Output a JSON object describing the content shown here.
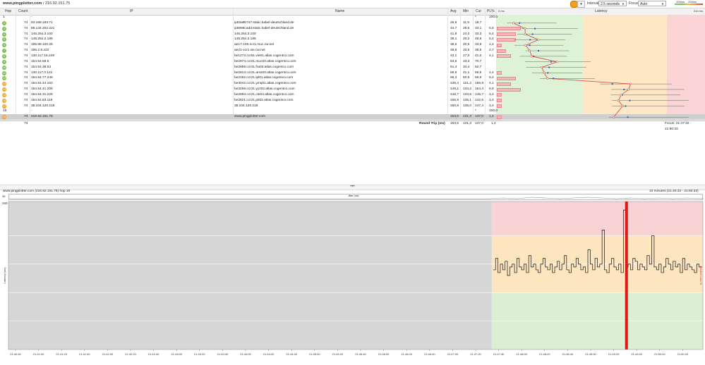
{
  "window": {
    "title_host": "www.pingplotter.com",
    "title_rest": "/ 216.92.151.75"
  },
  "toolbar": {
    "interval_label": "Interval",
    "interval_value": "2.5 seconds",
    "focus_label": "Focus",
    "focus_value": "Auto",
    "legend_good": "100ms",
    "legend_bad": "200ms"
  },
  "columns": {
    "hop": "Hop",
    "count": "Count",
    "ip": "IP",
    "name": "Name",
    "avg": "Avg",
    "min": "Min",
    "cur": "Cur",
    "pl": "PL%",
    "pl_scale": "0 ms",
    "latency": "Latency",
    "lat_max": "244 ms"
  },
  "hops": [
    {
      "hop": "1",
      "count": "",
      "ip": "-",
      "name": "",
      "avg": "",
      "min": "",
      "cur": "*",
      "pl": "100,0",
      "color": "none",
      "plbar": 0,
      "cur_ms": null,
      "min_ms": null,
      "max_ms": null
    },
    {
      "hop": "2",
      "count": "74",
      "ip": "83.169.183.71",
      "name": "ip53a9b747.static.kabel-deutschland.de",
      "avg": "26,6",
      "min": "11,9",
      "cur": "19,7",
      "pl": "",
      "color": "#7dbe4e",
      "plbar": 0,
      "cur_ms": 19.7,
      "min_ms": 11.9,
      "max_ms": 70
    },
    {
      "hop": "3",
      "count": "74",
      "ip": "88.134.202.221",
      "name": "ip5886cadd.static.kabel-deutschland.de",
      "avg": "44,7",
      "min": "28,6",
      "cur": "33,1",
      "pl": "6,8",
      "color": "#7dbe4e",
      "plbar": 34,
      "cur_ms": 33.1,
      "min_ms": 28.6,
      "max_ms": 95
    },
    {
      "hop": "4",
      "count": "74",
      "ip": "145.254.3.100",
      "name": "145.254.3.100",
      "avg": "41,9",
      "min": "24,0",
      "cur": "33,3",
      "pl": "5,4",
      "color": "#7dbe4e",
      "plbar": 27,
      "cur_ms": 33.3,
      "min_ms": 24,
      "max_ms": 88
    },
    {
      "hop": "5",
      "count": "74",
      "ip": "145.254.2.185",
      "name": "145.254.2.185",
      "avg": "39,1",
      "min": "20,2",
      "cur": "48,8",
      "pl": "5,4",
      "color": "#7dbe4e",
      "plbar": 27,
      "cur_ms": 48.8,
      "min_ms": 20.2,
      "max_ms": 80
    },
    {
      "hop": "6",
      "count": "74",
      "ip": "195.89.100.25",
      "name": "ae17-100.ncr1.muc.cw.net",
      "avg": "38,5",
      "min": "20,5",
      "cur": "33,9",
      "pl": "1,4",
      "color": "#7dbe4e",
      "plbar": 7,
      "cur_ms": 33.9,
      "min_ms": 20.5,
      "max_ms": 78
    },
    {
      "hop": "7",
      "count": "74",
      "ip": "195.2.8.222",
      "name": "ae21-xcr1.vie.cw.net",
      "avg": "48,8",
      "min": "33,5",
      "cur": "38,5",
      "pl": "2,7",
      "color": "#7dbe4e",
      "plbar": 13,
      "cur_ms": 38.5,
      "min_ms": 33.5,
      "max_ms": 85
    },
    {
      "hop": "8",
      "count": "74",
      "ip": "130.117.15.249",
      "name": "be1273.ccr51.vie01.atlas.cogentco.com",
      "avg": "43,1",
      "min": "27,0",
      "cur": "41,0",
      "pl": "4,1",
      "color": "#7dbe4e",
      "plbar": 20,
      "cur_ms": 41.0,
      "min_ms": 27,
      "max_ms": 82
    },
    {
      "hop": "9",
      "count": "74",
      "ip": "154.54.58.5",
      "name": "be2974.ccr21.muc03.atlas.cogentco.com",
      "avg": "63,6",
      "min": "33,3",
      "cur": "70,7",
      "pl": "",
      "color": "#7dbe4e",
      "plbar": 0,
      "cur_ms": 70.7,
      "min_ms": 33.3,
      "max_ms": 110
    },
    {
      "hop": "10",
      "count": "74",
      "ip": "154.54.38.53",
      "name": "be2959.ccr41.fra03.atlas.cogentco.com",
      "avg": "61,4",
      "min": "34,4",
      "cur": "52,7",
      "pl": "",
      "color": "#7dbe4e",
      "plbar": 0,
      "cur_ms": 52.7,
      "min_ms": 34.4,
      "max_ms": 105
    },
    {
      "hop": "11",
      "count": "74",
      "ip": "130.117.0.121",
      "name": "be2813.ccr41.ams03.atlas.cogentco.com",
      "avg": "59,8",
      "min": "41,1",
      "cur": "55,5",
      "pl": "1,4",
      "color": "#7dbe4e",
      "plbar": 7,
      "cur_ms": 55.5,
      "min_ms": 41.1,
      "max_ms": 100
    },
    {
      "hop": "12",
      "count": "74",
      "ip": "154.54.77.246",
      "name": "be2182.ccr21.lpl01.atlas.cogentco.com",
      "avg": "66,3",
      "min": "50,5",
      "cur": "59,5",
      "pl": "5,4",
      "color": "#7dbe4e",
      "plbar": 27,
      "cur_ms": 59.5,
      "min_ms": 50.5,
      "max_ms": 115
    },
    {
      "hop": "13",
      "count": "74",
      "ip": "154.54.44.162",
      "name": "be3042.ccr21.ymq01.atlas.cogentco.com",
      "avg": "135,4",
      "min": "121,2",
      "cur": "156,8",
      "pl": "4,1",
      "color": "#f0a030",
      "plbar": 20,
      "cur_ms": 156.8,
      "min_ms": 121.2,
      "max_ms": 205
    },
    {
      "hop": "14",
      "count": "74",
      "ip": "154.54.41.205",
      "name": "be3259.ccr31.yyz02.atlas.cogentco.com",
      "avg": "149,1",
      "min": "134,2",
      "cur": "154,4",
      "pl": "6,8",
      "color": "#f0a030",
      "plbar": 34,
      "cur_ms": 154.4,
      "min_ms": 134.2,
      "max_ms": 220
    },
    {
      "hop": "15",
      "count": "74",
      "ip": "154.54.31.225",
      "name": "be2993.ccr21.cle04.atlas.cogentco.com",
      "avg": "146,7",
      "min": "133,5",
      "cur": "145,7",
      "pl": "1,4",
      "color": "#f0a030",
      "plbar": 7,
      "cur_ms": 145.7,
      "min_ms": 133.5,
      "max_ms": 215
    },
    {
      "hop": "16",
      "count": "74",
      "ip": "154.54.83.118",
      "name": "be2821.ccr21.pit02.atlas.cogentco.com",
      "avg": "155,9",
      "min": "135,1",
      "cur": "142,6",
      "pl": "1,4",
      "color": "#f0a030",
      "plbar": 7,
      "cur_ms": 142.6,
      "min_ms": 135.1,
      "max_ms": 225
    },
    {
      "hop": "17",
      "count": "74",
      "ip": "38.104.120.218",
      "name": "38.104.120.218",
      "avg": "150,9",
      "min": "135,0",
      "cur": "147,4",
      "pl": "1,4",
      "color": "#f0a030",
      "plbar": 7,
      "cur_ms": 147.4,
      "min_ms": 135,
      "max_ms": 220
    },
    {
      "hop": "18",
      "count": "",
      "ip": "-",
      "name": "",
      "avg": "",
      "min": "",
      "cur": "*",
      "pl": "100,0",
      "color": "none",
      "plbar": 0,
      "cur_ms": null,
      "min_ms": null,
      "max_ms": null
    },
    {
      "hop": "19",
      "count": "73",
      "ip": "216.92.151.75",
      "name": "www.pingplotter.com",
      "avg": "153,5",
      "min": "131,3",
      "cur": "137,0",
      "pl": "1,4",
      "color": "#f0a030",
      "plbar": 7,
      "cur_ms": 137.0,
      "min_ms": 131.3,
      "max_ms": 225,
      "selected": true
    }
  ],
  "summary": {
    "count": "73",
    "round_trip_label": "Round Trip (ms)",
    "avg": "153,5",
    "min": "131,3",
    "cur": "137,0",
    "pl": "1,4",
    "focus_range": "Focus: 21:47:32 - 21:50:33"
  },
  "lower": {
    "header_left": "www.pingplotter.com (216.92.151.75) hop 19",
    "header_right": "10 minutes (21:40:33 - 21:50:33)",
    "mini_left": "35",
    "mini_label": "Jitter (ms)",
    "y_top": "260",
    "y_label": "Latency (ms)",
    "right_label": "Packet Loss %",
    "x_ticks": [
      "21:40:40",
      "21:41:00",
      "21:41:20",
      "21:41:40",
      "21:42:00",
      "21:42:20",
      "21:42:40",
      "21:43:00",
      "21:43:20",
      "21:43:40",
      "21:44:00",
      "21:44:20",
      "21:44:40",
      "21:45:00",
      "21:45:20",
      "21:45:40",
      "21:46:00",
      "21:46:20",
      "21:46:40",
      "21:47:00",
      "21:47:20",
      "21:47:40",
      "21:48:00",
      "21:48:20",
      "21:48:40",
      "21:49:00",
      "21:49:20",
      "21:49:40",
      "21:50:00",
      "21:50:20"
    ]
  },
  "chart_data": {
    "type": "line",
    "title": "",
    "xlabel": "",
    "ylabel": "Latency (ms)",
    "ylim": [
      0,
      260
    ],
    "series": [
      {
        "values": [
          140,
          160,
          135,
          150,
          140,
          155,
          130,
          145,
          150,
          135,
          160,
          145,
          140,
          150,
          135,
          165,
          145,
          150,
          140,
          135,
          150,
          160,
          145,
          140,
          150,
          135,
          145,
          155,
          140,
          150,
          165,
          140,
          135,
          150,
          145,
          160,
          150,
          140,
          145,
          135,
          175,
          150,
          140,
          160,
          145,
          150,
          210,
          140,
          135,
          150,
          160,
          145,
          140,
          150,
          135,
          245,
          145,
          150,
          140,
          160,
          155,
          140,
          150,
          145,
          140,
          165,
          150,
          200,
          145,
          140,
          150,
          135,
          145,
          160,
          150,
          140,
          155,
          145,
          150,
          135,
          160,
          140,
          150,
          145,
          140,
          135,
          150,
          145
        ]
      }
    ],
    "packet_loss_marker": 0.89
  }
}
